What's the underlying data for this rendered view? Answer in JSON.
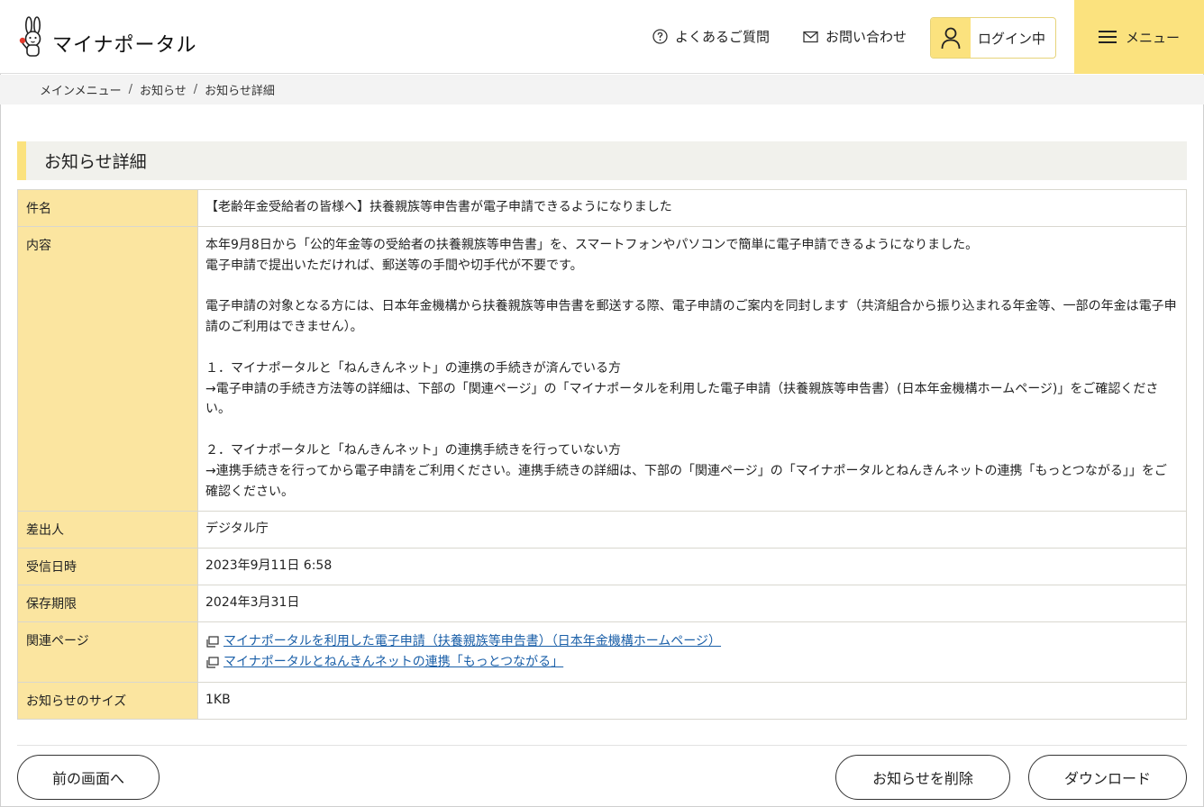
{
  "header": {
    "logo_text": "マイナポータル",
    "faq_label": "よくあるご質問",
    "contact_label": "お問い合わせ",
    "login_label": "ログイン中",
    "menu_label": "メニュー"
  },
  "breadcrumb": {
    "items": [
      "メインメニュー",
      "お知らせ",
      "お知らせ詳細"
    ]
  },
  "page_title": "お知らせ詳細",
  "detail": {
    "subject_label": "件名",
    "subject": "【老齢年金受給者の皆様へ】扶養親族等申告書が電子申請できるようになりました",
    "content_label": "内容",
    "content": "本年9月8日から「公的年金等の受給者の扶養親族等申告書」を、スマートフォンやパソコンで簡単に電子申請できるようになりました。\n電子申請で提出いただければ、郵送等の手間や切手代が不要です。\n\n電子申請の対象となる方には、日本年金機構から扶養親族等申告書を郵送する際、電子申請のご案内を同封します（共済組合から振り込まれる年金等、一部の年金は電子申請のご利用はできません）。\n\n１．マイナポータルと「ねんきんネット」の連携の手続きが済んでいる方\n→電子申請の手続き方法等の詳細は、下部の「関連ページ」の「マイナポータルを利用した電子申請（扶養親族等申告書）(日本年金機構ホームページ)」をご確認ください。\n\n２．マイナポータルと「ねんきんネット」の連携手続きを行っていない方\n→連携手続きを行ってから電子申請をご利用ください。連携手続きの詳細は、下部の「関連ページ」の「マイナポータルとねんきんネットの連携「もっとつながる」」をご確認ください。",
    "sender_label": "差出人",
    "sender": "デジタル庁",
    "received_label": "受信日時",
    "received": "2023年9月11日 6:58",
    "retention_label": "保存期限",
    "retention": "2024年3月31日",
    "related_label": "関連ページ",
    "related_links": [
      "マイナポータルを利用した電子申請（扶養親族等申告書）（日本年金機構ホームページ）",
      "マイナポータルとねんきんネットの連携「もっとつながる」"
    ],
    "size_label": "お知らせのサイズ",
    "size": "1KB"
  },
  "buttons": {
    "back": "前の画面へ",
    "delete": "お知らせを削除",
    "download": "ダウンロード"
  },
  "colors": {
    "accent_yellow": "#fbe27e",
    "label_cell": "#fbe5a0",
    "link": "#1a5fa8"
  }
}
